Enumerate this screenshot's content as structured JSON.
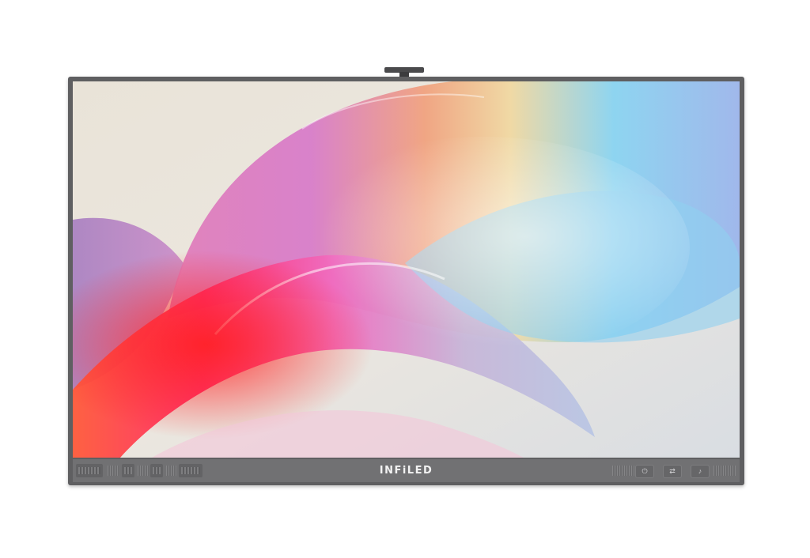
{
  "brand": {
    "logo_text": "INFiLED"
  },
  "colors": {
    "frame": "#5f5f61",
    "bottom_bar": "#717173",
    "logo": "#f2f2f2",
    "background": "#ffffff"
  },
  "icons": {
    "camera": "camera-icon",
    "buttons": [
      "power-icon",
      "input-icon",
      "volume-icon"
    ]
  }
}
